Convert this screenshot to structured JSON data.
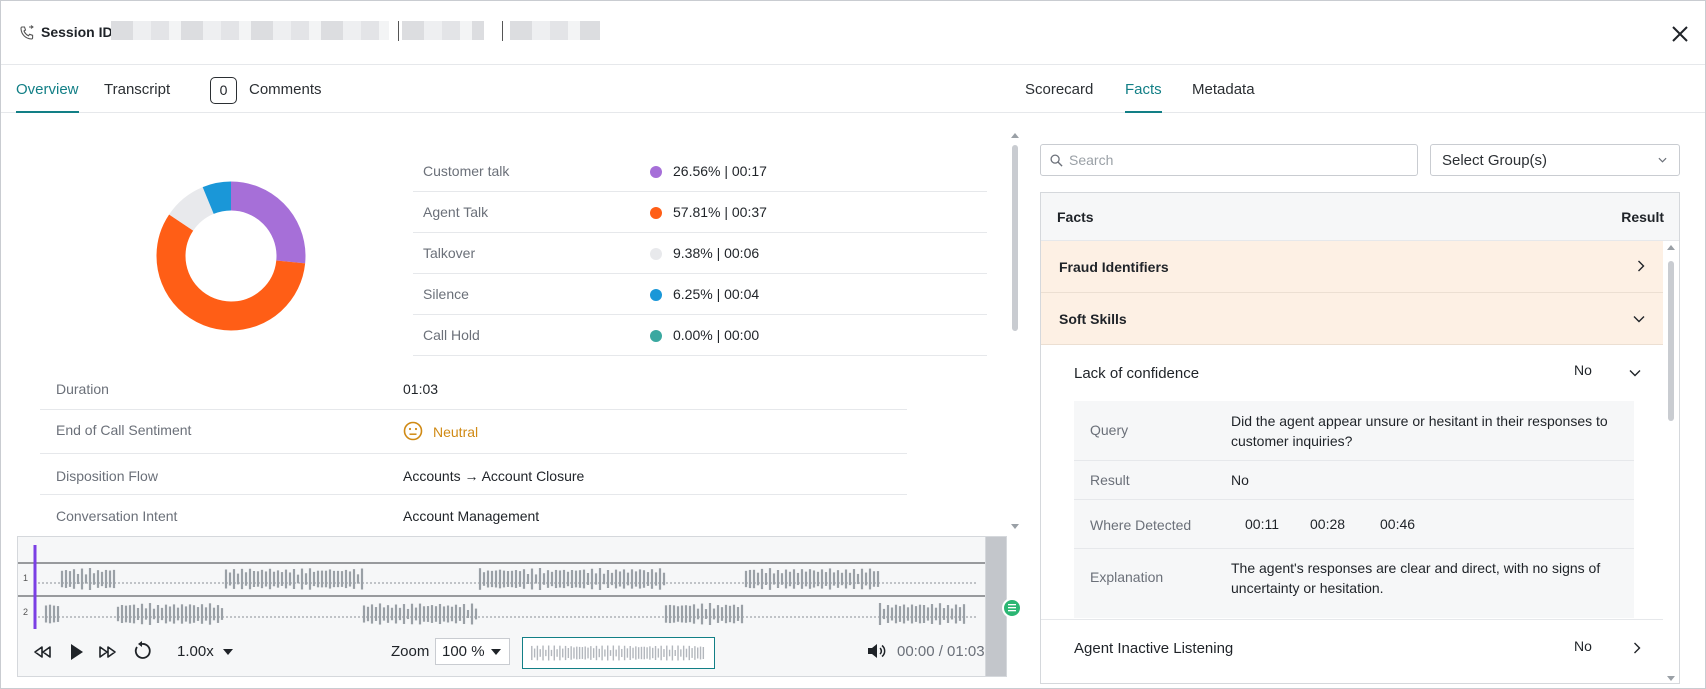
{
  "header": {
    "session_label": "Session ID:",
    "close_icon": "close-icon"
  },
  "tabs_left": [
    {
      "label": "Overview",
      "active": true
    },
    {
      "label": "Transcript",
      "active": false
    },
    {
      "label": "Comments",
      "count": "0",
      "active": false
    }
  ],
  "tabs_right": [
    {
      "label": "Scorecard",
      "active": false
    },
    {
      "label": "Facts",
      "active": true
    },
    {
      "label": "Metadata",
      "active": false
    }
  ],
  "talk_stats": [
    {
      "label": "Customer talk",
      "value": "26.56% | 00:17",
      "color": "#a66fd8",
      "pct": 26.56
    },
    {
      "label": "Agent Talk",
      "value": "57.81% | 00:37",
      "color": "#ff5e16",
      "pct": 57.81
    },
    {
      "label": "Talkover",
      "value": "9.38% | 00:06",
      "color": "#e8e9ec",
      "pct": 9.38
    },
    {
      "label": "Silence",
      "value": "6.25% | 00:04",
      "color": "#1a97d8",
      "pct": 6.25
    },
    {
      "label": "Call Hold",
      "value": "0.00% | 00:00",
      "color": "#3aa8a0",
      "pct": 0.0
    }
  ],
  "info": [
    {
      "label": "Duration",
      "value": "01:03"
    },
    {
      "label": "End of Call Sentiment",
      "value": "Neutral"
    },
    {
      "label": "Disposition Flow",
      "value": "Accounts → Account Closure"
    },
    {
      "label": "Conversation Intent",
      "value": "Account Management"
    }
  ],
  "player": {
    "speed": "1.00x",
    "zoom_label": "Zoom",
    "zoom_value": "100 %",
    "time": "00:00 / 01:03",
    "channel_1": "1",
    "channel_2": "2"
  },
  "facts": {
    "search_placeholder": "Search",
    "group_select": "Select Group(s)",
    "col_facts": "Facts",
    "col_result": "Result",
    "groups": [
      {
        "label": "Fraud Identifiers",
        "expanded": false
      },
      {
        "label": "Soft Skills",
        "expanded": true
      }
    ],
    "items": [
      {
        "label": "Lack of confidence",
        "result": "No",
        "details": {
          "query_label": "Query",
          "query": "Did the agent appear unsure or hesitant in their responses to customer inquiries?",
          "result_label": "Result",
          "result": "No",
          "where_label": "Where Detected",
          "where": [
            "00:11",
            "00:28",
            "00:46"
          ],
          "explanation_label": "Explanation",
          "explanation": "The agent's responses are clear and direct, with no signs of uncertainty or hesitation."
        }
      },
      {
        "label": "Agent Inactive Listening",
        "result": "No"
      }
    ]
  },
  "colors": {
    "accent": "#127f86",
    "group_bg": "#fdf0e4",
    "neutral": "#d08a15",
    "wave_cursor": "#7b3fe4"
  }
}
